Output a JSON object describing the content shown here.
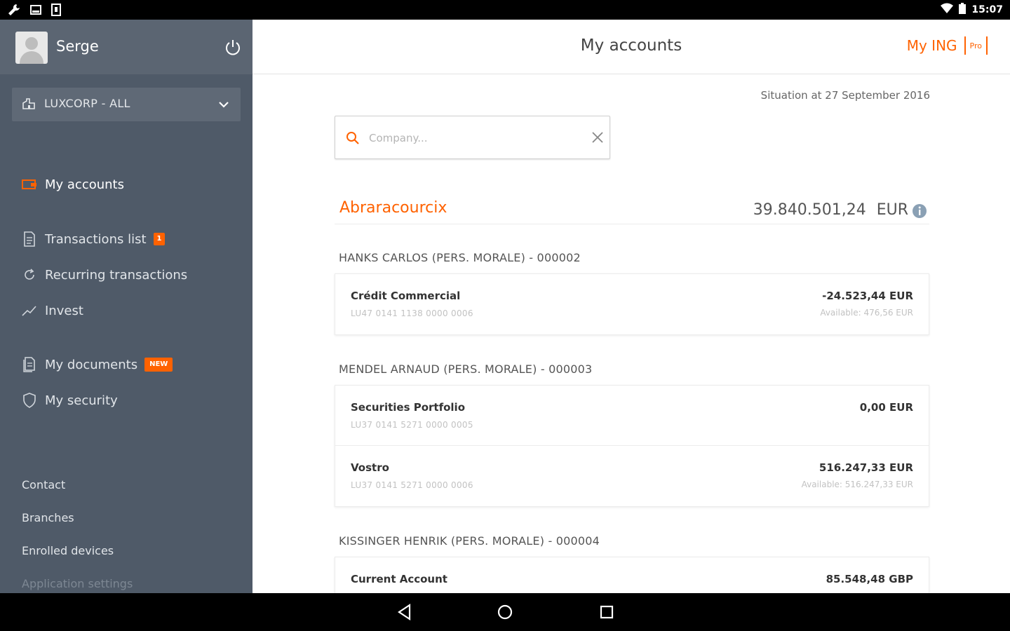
{
  "status_bar": {
    "time": "15:07",
    "left_icons": [
      "wrench-icon",
      "tray-icon",
      "sim-icon"
    ],
    "right_icons": [
      "wifi-icon",
      "battery-icon"
    ]
  },
  "sidebar": {
    "user_name": "Serge",
    "company_select": "LUXCORP - ALL",
    "nav": [
      {
        "label": "My accounts",
        "icon": "wallet-icon",
        "active": true
      },
      {
        "label": "Transactions list",
        "icon": "document-icon",
        "badge": "1"
      },
      {
        "label": "Recurring transactions",
        "icon": "refresh-icon"
      },
      {
        "label": "Invest",
        "icon": "trend-icon"
      },
      {
        "label": "My documents",
        "icon": "documents-icon",
        "badge": "NEW"
      },
      {
        "label": "My security",
        "icon": "shield-icon"
      }
    ],
    "links": [
      "Contact",
      "Branches",
      "Enrolled devices",
      "Application settings"
    ]
  },
  "header": {
    "title": "My accounts",
    "brand": "My ING",
    "brand_badge": "Pro"
  },
  "situation": "Situation at 27 September 2016",
  "search": {
    "placeholder": "Company..."
  },
  "group": {
    "name": "Abraracourcix",
    "total": "39.840.501,24",
    "currency": "EUR"
  },
  "holders": [
    {
      "title": "HANKS CARLOS (PERS. MORALE) - 000002",
      "accounts": [
        {
          "name": "Crédit Commercial",
          "iban": "LU47 0141 1138 0000 0006",
          "balance": "-24.523,44  EUR",
          "available": "Available: 476,56  EUR"
        }
      ]
    },
    {
      "title": "MENDEL ARNAUD (PERS. MORALE) - 000003",
      "accounts": [
        {
          "name": "Securities Portfolio",
          "iban": "LU37 0141 5271 0000 0005",
          "balance": "0,00  EUR",
          "available": ""
        },
        {
          "name": "Vostro",
          "iban": "LU37 0141 5271 0000 0006",
          "balance": "516.247,33  EUR",
          "available": "Available: 516.247,33  EUR"
        }
      ]
    },
    {
      "title": "KISSINGER HENRIK (PERS. MORALE) - 000004",
      "accounts": [
        {
          "name": "Current Account",
          "iban": "",
          "balance": "85.548,48  GBP",
          "available": ""
        }
      ]
    }
  ],
  "colors": {
    "accent": "#ff6200",
    "sidebar": "#4f5a68",
    "sidebar_header": "#5b6572"
  }
}
